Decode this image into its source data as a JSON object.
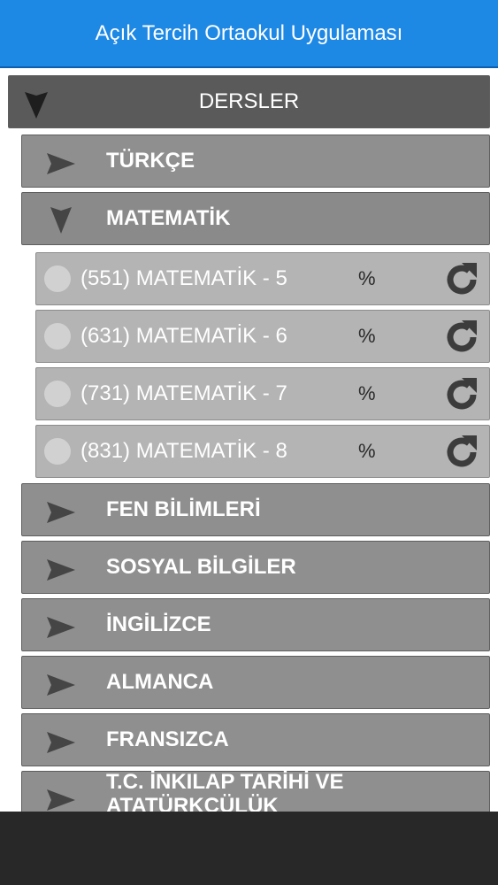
{
  "app": {
    "title": "Açık Tercih Ortaokul Uygulaması"
  },
  "root": {
    "label": "DERSLER",
    "expanded": true
  },
  "categories": [
    {
      "label": "TÜRKÇE",
      "expanded": false
    },
    {
      "label": "MATEMATİK",
      "expanded": true
    },
    {
      "label": "FEN BİLİMLERİ",
      "expanded": false
    },
    {
      "label": "SOSYAL BİLGİLER",
      "expanded": false
    },
    {
      "label": "İNGİLİZCE",
      "expanded": false
    },
    {
      "label": "ALMANCA",
      "expanded": false
    },
    {
      "label": "FRANSIZCA",
      "expanded": false
    },
    {
      "label": "T.C. İNKILAP TARİHİ VE ATATÜRKÇÜLÜK",
      "expanded": false
    }
  ],
  "courses": [
    {
      "label": "(551) MATEMATİK - 5",
      "percent": "%"
    },
    {
      "label": "(631) MATEMATİK - 6",
      "percent": "%"
    },
    {
      "label": "(731) MATEMATİK - 7",
      "percent": "%"
    },
    {
      "label": "(831) MATEMATİK - 8",
      "percent": "%"
    }
  ],
  "colors": {
    "appbar": "#1e88e5",
    "root": "#5a5a5a",
    "category": "#8f8f8f",
    "course": "#b5b4b5",
    "navbar": "#282828"
  },
  "icons": {
    "collapsed": "arrow-right-icon",
    "expanded": "arrow-down-icon",
    "course_action": "refresh-icon",
    "course_select": "radio-icon"
  }
}
